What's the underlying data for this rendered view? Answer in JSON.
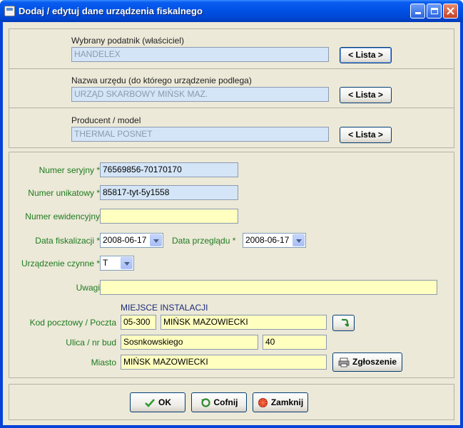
{
  "window": {
    "title": "Dodaj / edytuj dane urządzenia fiskalnego"
  },
  "owner": {
    "label": "Wybrany podatnik (właściciel)",
    "value": "HANDELEX",
    "button": "< Lista >"
  },
  "office": {
    "label": "Nazwa urzędu (do którego urządzenie podlega)",
    "value": "URZĄD SKARBOWY MIŃSK MAZ.",
    "button": "< Lista >"
  },
  "producer": {
    "label": "Producent / model",
    "value": "THERMAL POSNET",
    "button": "< Lista >"
  },
  "form": {
    "serial_label": "Numer seryjny *",
    "serial_value": "76569856-70170170",
    "unique_label": "Numer unikatowy *",
    "unique_value": "85817-tyt-5y1558",
    "evidence_label": "Numer ewidencyjny",
    "evidence_value": "",
    "fiscal_date_label": "Data fiskalizacji *",
    "fiscal_date_value": "2008-06-17",
    "review_date_label": "Data przeglądu *",
    "review_date_value": "2008-06-17",
    "active_label": "Urządzenie czynne *",
    "active_value": "T",
    "notes_label": "Uwagi",
    "notes_value": "",
    "install_header": "MIEJSCE INSTALACJI",
    "postal_label": "Kod pocztowy / Poczta",
    "postal_code": "05-300",
    "post_office": "MIŃSK MAZOWIECKI",
    "street_label": "Ulica / nr bud",
    "street": "Sosnkowskiego",
    "building_no": "40",
    "city_label": "Miasto",
    "city": "MIŃSK MAZOWIECKI",
    "report_button": "Zgłoszenie"
  },
  "footer": {
    "ok": "OK",
    "undo": "Cofnij",
    "close": "Zamknij"
  },
  "colors": {
    "label_green": "#1e7a1e",
    "field_blue": "#d4e5f7",
    "field_yellow": "#ffffc0",
    "title_blue": "#0052e6"
  }
}
